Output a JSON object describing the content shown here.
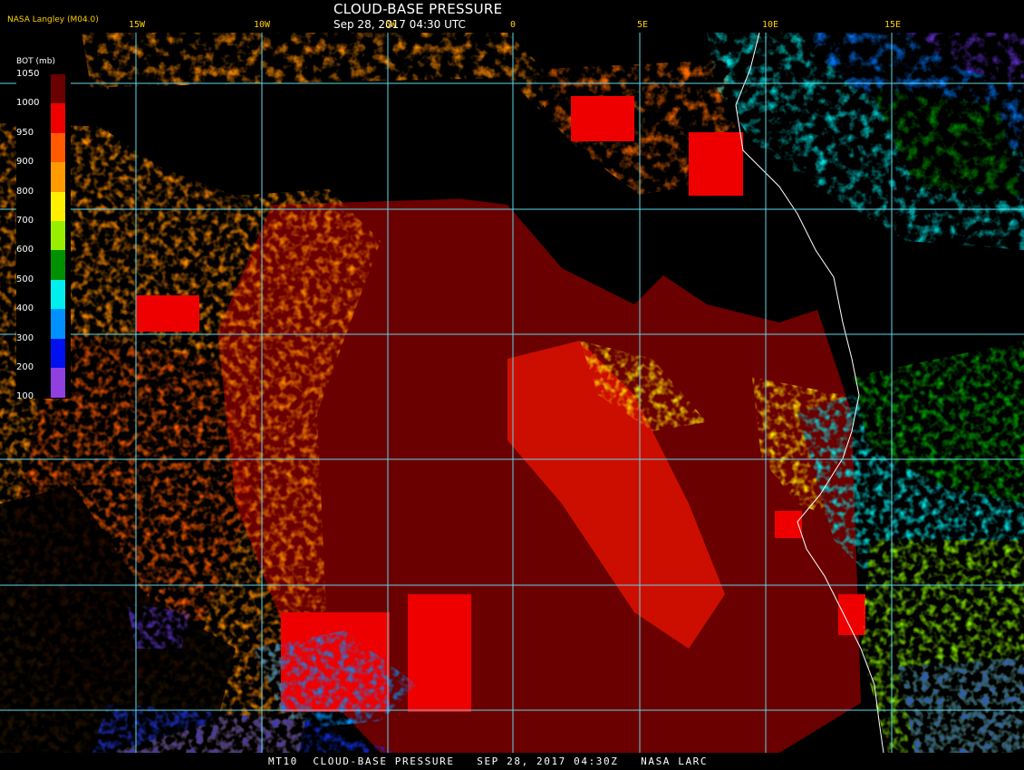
{
  "header": {
    "title": "CLOUD-BASE PRESSURE",
    "subtitle": "Sep 28, 2017 04:30 UTC",
    "credit": "NASA Langley (M04.0)",
    "lon_labels": [
      "15W",
      "10W",
      "5W",
      "0",
      "5E",
      "10E",
      "15E"
    ]
  },
  "legend": {
    "title": "BOT (mb)",
    "entries": [
      {
        "label": "1050",
        "color": "#6b0000"
      },
      {
        "label": "1000",
        "color": "#ee0000"
      },
      {
        "label": "950",
        "color": "#ff5a00"
      },
      {
        "label": "900",
        "color": "#ff9a00"
      },
      {
        "label": "800",
        "color": "#ffee00"
      },
      {
        "label": "700",
        "color": "#99ee00"
      },
      {
        "label": "600",
        "color": "#009000"
      },
      {
        "label": "500",
        "color": "#00eeee"
      },
      {
        "label": "400",
        "color": "#0090ff"
      },
      {
        "label": "300",
        "color": "#0010ee"
      },
      {
        "label": "200",
        "color": "#9040e0"
      },
      {
        "label": "100",
        "color": ""
      }
    ]
  },
  "footer": {
    "text": "MT10  CLOUD-BASE PRESSURE   SEP 28, 2017 04:30Z   NASA LARC"
  },
  "colors": {
    "grid": "#5fd8e8",
    "coast": "#ffffff",
    "background": "#000000"
  }
}
